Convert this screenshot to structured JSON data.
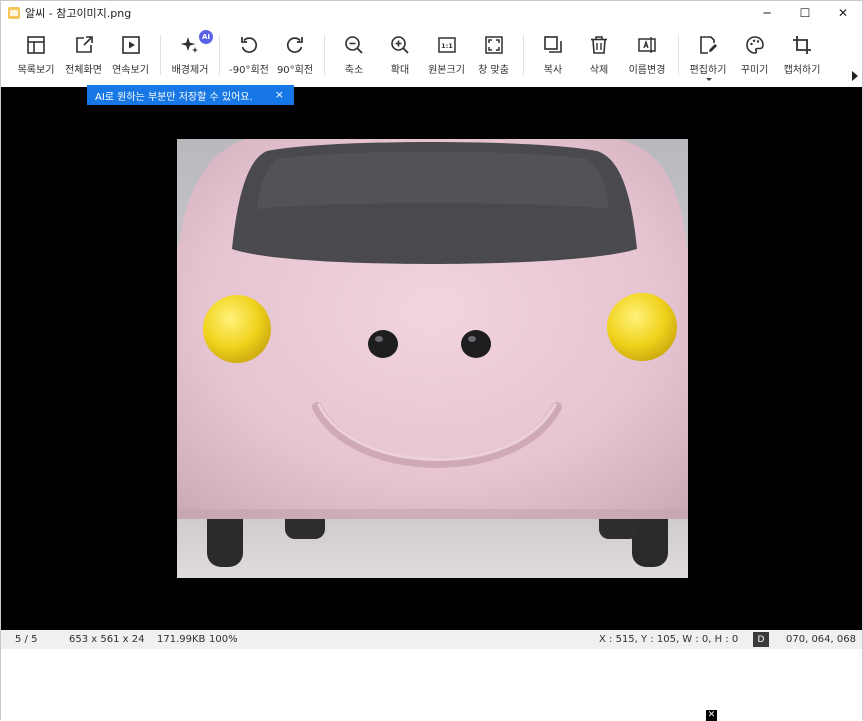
{
  "window": {
    "title": "알씨 - 참고이미지.png",
    "controls": {
      "minimize": "─",
      "maximize": "☐",
      "close": "✕"
    }
  },
  "toolbar": {
    "items": [
      {
        "label": "목록보기",
        "icon": "list-view-icon"
      },
      {
        "label": "전체화면",
        "icon": "fullscreen-icon"
      },
      {
        "label": "연속보기",
        "icon": "slideshow-icon"
      },
      {
        "label": "배경제거",
        "icon": "background-remove-icon",
        "badge": "AI"
      },
      {
        "label": "-90°회전",
        "icon": "rotate-left-icon"
      },
      {
        "label": "90°회전",
        "icon": "rotate-right-icon"
      },
      {
        "label": "축소",
        "icon": "zoom-out-icon"
      },
      {
        "label": "확대",
        "icon": "zoom-in-icon"
      },
      {
        "label": "원본크기",
        "icon": "original-size-icon",
        "glyph": "1:1"
      },
      {
        "label": "창 맞춤",
        "icon": "fit-window-icon"
      },
      {
        "label": "복사",
        "icon": "copy-icon"
      },
      {
        "label": "삭제",
        "icon": "delete-icon"
      },
      {
        "label": "이름변경",
        "icon": "rename-icon"
      },
      {
        "label": "편집하기",
        "icon": "edit-icon"
      },
      {
        "label": "꾸미기",
        "icon": "decorate-palette-icon"
      },
      {
        "label": "캡처하기",
        "icon": "capture-crop-icon"
      }
    ]
  },
  "tooltip": {
    "text": "AI로 원하는 부분만 저장할 수 있어요.",
    "close": "×",
    "color": "#1677e5"
  },
  "statusbar": {
    "page": "5 / 5",
    "dimensions": "653 x 561 x 24",
    "filesize": "171.99KB",
    "zoom": "100%",
    "coords": "X : 515, Y : 105, W : 0, H : 0",
    "badge": "D",
    "color_value": "070, 064, 068"
  },
  "ad": {
    "close": "✕"
  },
  "colors": {
    "car_body": "#e9c9d6",
    "headlight": "#f0d21c",
    "windshield": "#4a4a4e",
    "accent": "#1677e5",
    "ai_badge": "#5a63e8"
  }
}
